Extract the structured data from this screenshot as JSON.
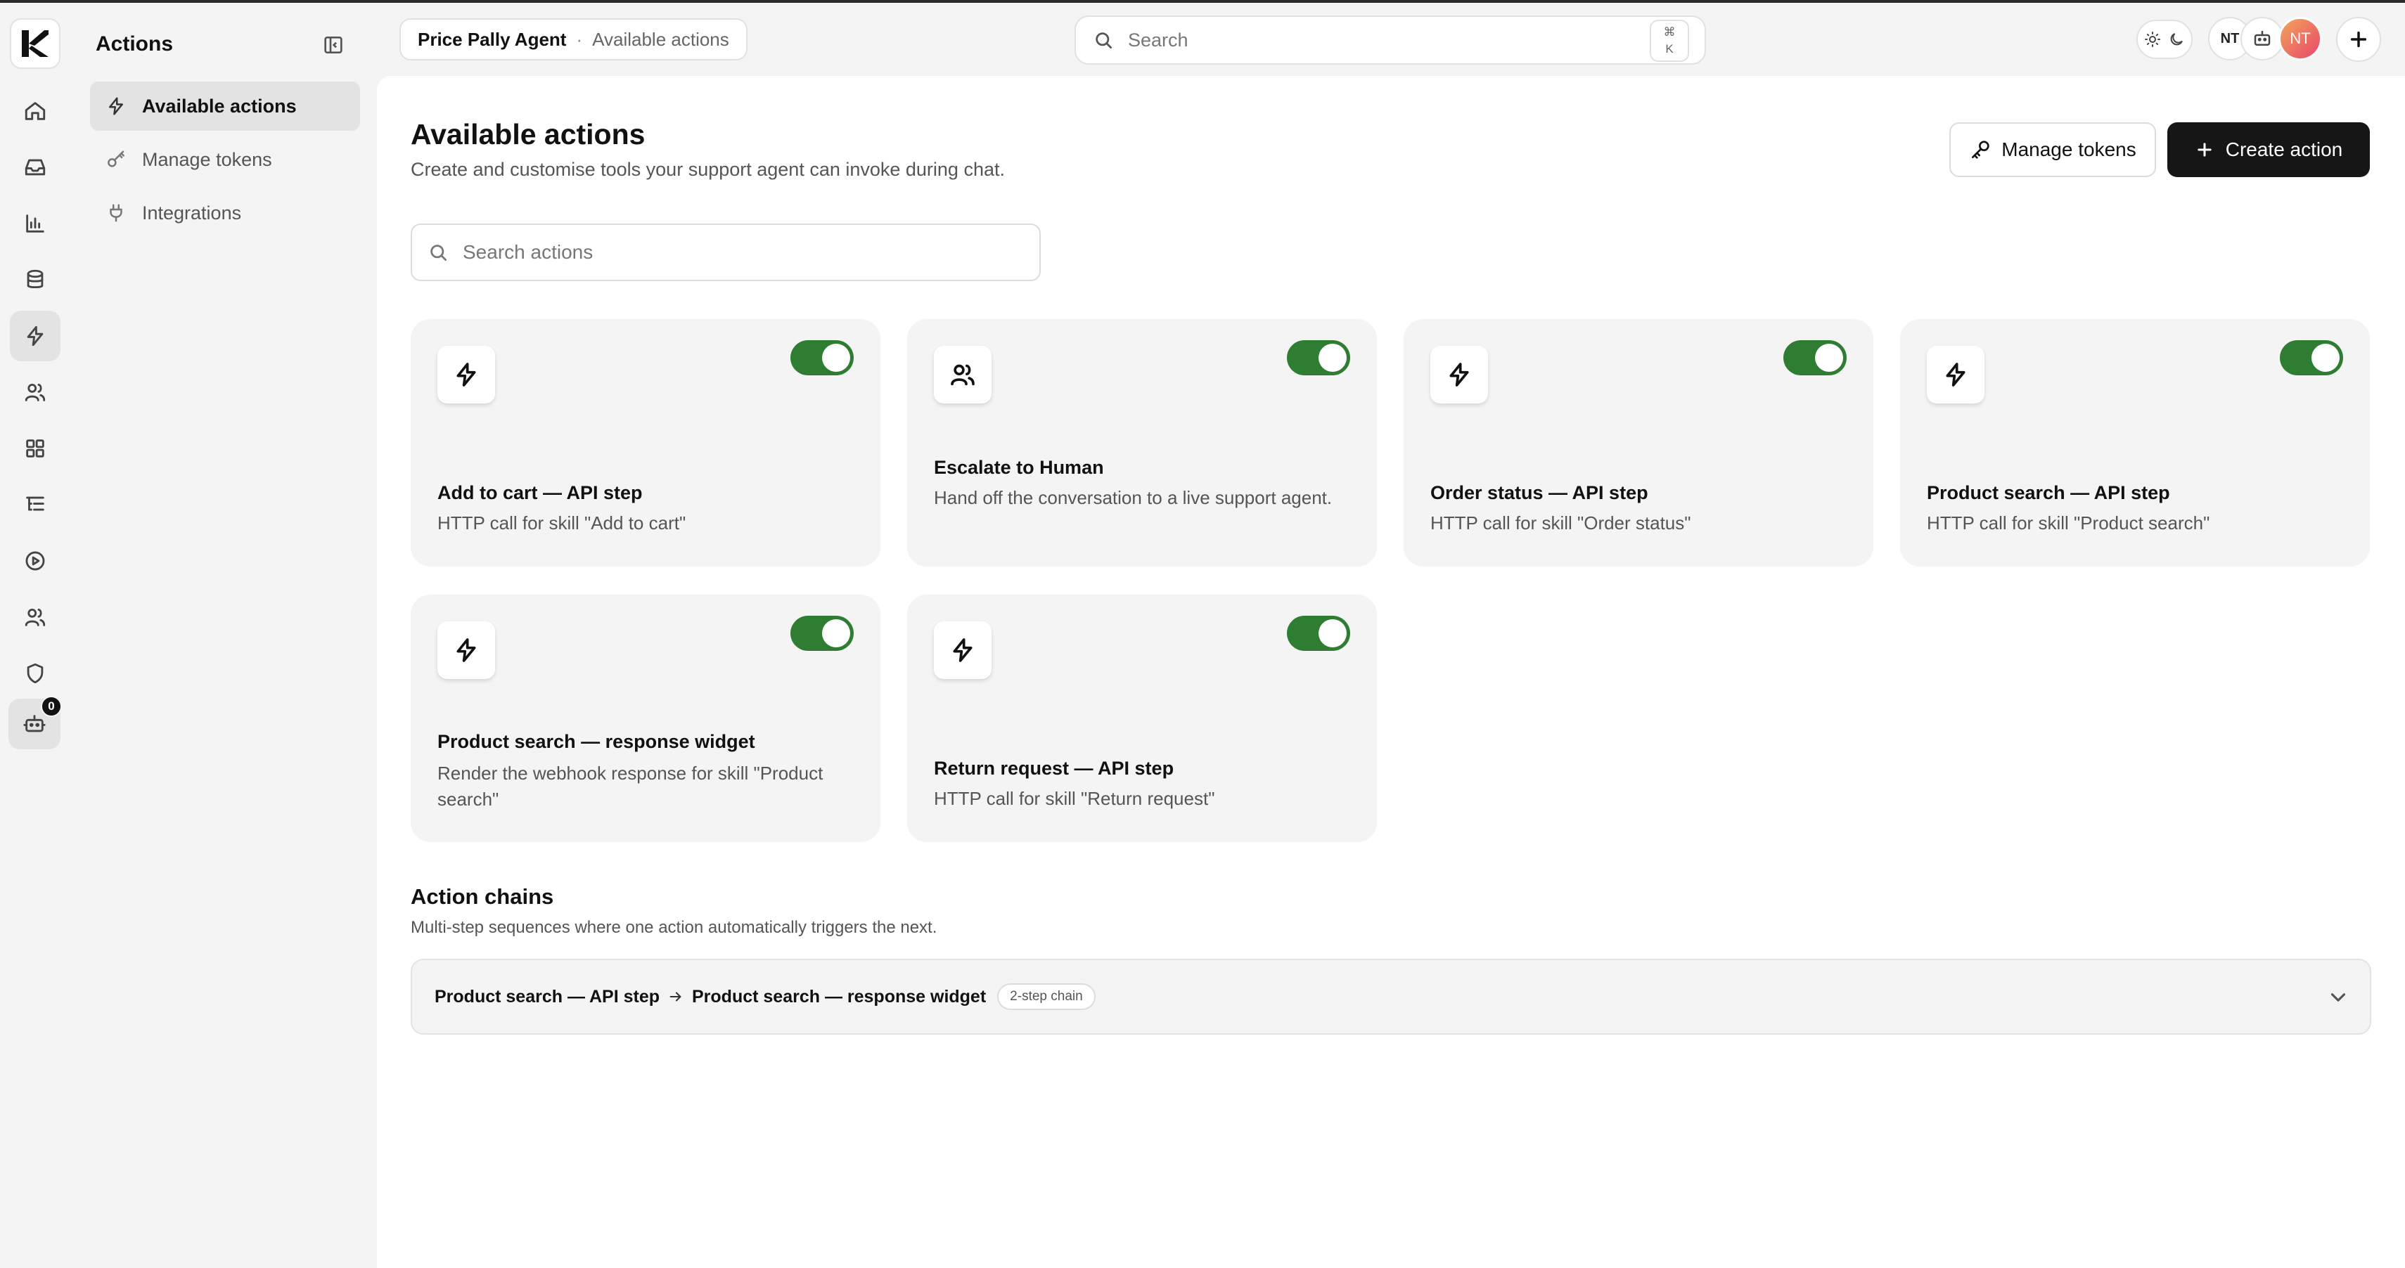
{
  "sidebar": {
    "title": "Actions",
    "items": [
      {
        "label": "Available actions",
        "icon": "lightning-icon",
        "active": true
      },
      {
        "label": "Manage tokens",
        "icon": "key-icon",
        "active": false
      },
      {
        "label": "Integrations",
        "icon": "plug-icon",
        "active": false
      }
    ]
  },
  "rail": {
    "icons": [
      "home-icon",
      "inbox-icon",
      "bar-chart-icon",
      "database-icon",
      "lightning-icon",
      "users-icon",
      "grid-icon",
      "list-tree-icon",
      "play-circle-icon",
      "team-icon",
      "shield-icon",
      "bot-icon"
    ],
    "active": "lightning-icon",
    "bot_badge": "0"
  },
  "breadcrumb": {
    "agent": "Price Pally Agent",
    "separator": "·",
    "page": "Available actions"
  },
  "search": {
    "placeholder": "Search",
    "shortcut_top": "⌘",
    "shortcut_bottom": "K"
  },
  "presence": {
    "initials": "NT",
    "avatar_initials": "NT"
  },
  "header": {
    "title": "Available actions",
    "subtitle": "Create and customise tools your support agent can invoke during chat.",
    "manage_tokens_label": "Manage tokens",
    "create_action_label": "Create action"
  },
  "actions_search": {
    "placeholder": "Search actions"
  },
  "actions": [
    {
      "name": "Add to cart — API step",
      "description": "HTTP call for skill \"Add to cart\"",
      "icon": "lightning-icon",
      "enabled": true
    },
    {
      "name": "Escalate to Human",
      "description": "Hand off the conversation to a live support agent.",
      "icon": "users-icon",
      "enabled": true
    },
    {
      "name": "Order status — API step",
      "description": "HTTP call for skill \"Order status\"",
      "icon": "lightning-icon",
      "enabled": true
    },
    {
      "name": "Product search — API step",
      "description": "HTTP call for skill \"Product search\"",
      "icon": "lightning-icon",
      "enabled": true
    },
    {
      "name": "Product search — response widget",
      "description": "Render the webhook response for skill \"Product search\"",
      "icon": "lightning-icon",
      "enabled": true
    },
    {
      "name": "Return request — API step",
      "description": "HTTP call for skill \"Return request\"",
      "icon": "lightning-icon",
      "enabled": true
    }
  ],
  "chains": {
    "title": "Action chains",
    "subtitle": "Multi-step sequences where one action automatically triggers the next.",
    "items": [
      {
        "from": "Product search — API step",
        "to": "Product search — response widget",
        "badge": "2-step chain"
      }
    ]
  },
  "colors": {
    "toggle_on": "#2e7d32",
    "primary_button": "#161616",
    "avatar_gradient_start": "#f2a65a",
    "avatar_gradient_end": "#e9456b"
  }
}
